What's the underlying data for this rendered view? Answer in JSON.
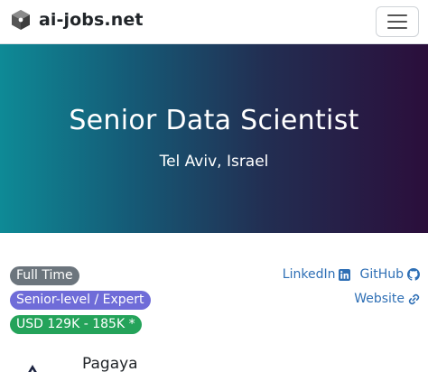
{
  "navbar": {
    "brand": "ai-jobs.net",
    "logo_icon": "ai-jobs-logo-icon",
    "menu_icon": "hamburger-menu-icon"
  },
  "hero": {
    "title": "Senior Data Scientist",
    "location": "Tel Aviv, Israel",
    "gradient_start": "#0e8a96",
    "gradient_end": "#2b0e3b"
  },
  "badges": {
    "employment_type": "Full Time",
    "level": "Senior-level / Expert",
    "salary": "USD 129K - 185K *"
  },
  "links": {
    "linkedin": "LinkedIn",
    "github": "GitHub",
    "website": "Website",
    "color": "#2e6fb5"
  },
  "company": {
    "name": "Pagaya"
  }
}
